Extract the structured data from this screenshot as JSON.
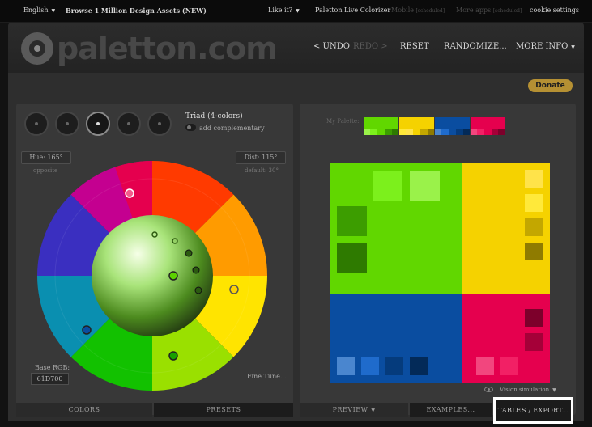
{
  "topbar": {
    "language": "English",
    "browse": "Browse 1 Million Design Assets (NEW)",
    "like": "Like it?",
    "live": "Paletton Live Colorizer",
    "mobile": "Mobile",
    "mobile_tag": "[scheduled]",
    "more_apps": "More apps",
    "more_apps_tag": "[scheduled]",
    "cookie": "cookie settings"
  },
  "header": {
    "logo_text": "paletton.com",
    "undo": "< UNDO",
    "redo": "REDO >",
    "reset": "RESET",
    "randomize": "RANDOMIZE...",
    "more_info": "MORE INFO"
  },
  "donate": "Donate",
  "scheme": {
    "name": "Triad (4-colors)",
    "add_complementary": "add complementary",
    "modes": [
      "mono-icon",
      "adjacent-icon",
      "triad-icon",
      "tetrad-icon",
      "free-icon"
    ],
    "active_mode": 2
  },
  "wheel": {
    "hue": "Hue: 165°",
    "hue_caption": "opposite",
    "dist": "Dist: 115°",
    "dist_caption": "default: 30°",
    "base_label": "Base RGB:",
    "base_value": "61D700",
    "fine_tune": "Fine Tune..."
  },
  "left_tabs": [
    "COLORS",
    "PRESETS"
  ],
  "palette": {
    "label": "My Palette:",
    "colors": {
      "primary": [
        "#61D700",
        "#7CF01C",
        "#9AF24A",
        "#3C9D00",
        "#2E7A00"
      ],
      "secondary1": [
        "#F5D200",
        "#FFE34A",
        "#FFE93A",
        "#C3A700",
        "#8F7B00"
      ],
      "secondary2": [
        "#0A4DA0",
        "#4A86CF",
        "#1F6BCC",
        "#053B7C",
        "#032A58"
      ],
      "complement": [
        "#E5004E",
        "#F2467E",
        "#F22065",
        "#7D002B",
        "#A50038"
      ]
    }
  },
  "right_tabs": {
    "preview": "PREVIEW",
    "examples": "EXAMPLES...",
    "tables": "TABLES / EXPORT..."
  },
  "vision": "Vision simulation"
}
